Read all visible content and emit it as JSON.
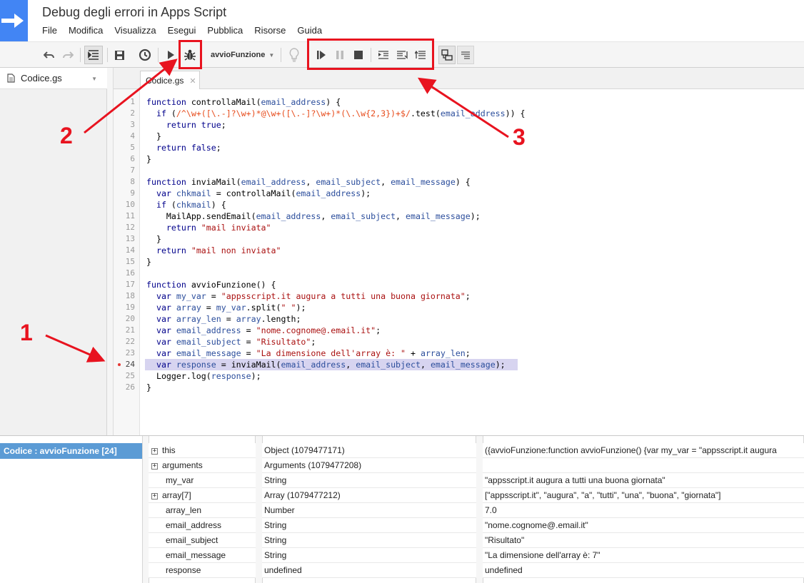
{
  "header": {
    "title": "Debug degli errori in Apps Script",
    "menu": [
      "File",
      "Modifica",
      "Visualizza",
      "Esegui",
      "Pubblica",
      "Risorse",
      "Guida"
    ]
  },
  "toolbar": {
    "function_select": "avvioFunzione",
    "icons": [
      "undo-icon",
      "redo-icon",
      "indent-icon",
      "save-icon",
      "triggers-icon",
      "run-icon",
      "debug-icon",
      "lightbulb-icon",
      "continue-icon",
      "pause-icon",
      "stop-icon",
      "step-into-icon",
      "step-over-icon",
      "step-out-icon",
      "split-view-icon",
      "log-view-icon"
    ]
  },
  "files": {
    "items": [
      {
        "name": "Codice.gs"
      }
    ]
  },
  "tabs": [
    {
      "label": "Codice.gs"
    }
  ],
  "editor": {
    "current_line": 24,
    "breakpoint_line": 24,
    "lines": [
      "function controllaMail(email_address) {",
      "  if (/^\\w+([\\.-]?\\w+)*@\\w+([\\.-]?\\w+)*(\\.\\w{2,3})+$/.test(email_address)) {",
      "    return true;",
      "  }",
      "  return false;",
      "}",
      "",
      "function inviaMail(email_address, email_subject, email_message) {",
      "  var chkmail = controllaMail(email_address);",
      "  if (chkmail) {",
      "    MailApp.sendEmail(email_address, email_subject, email_message);",
      "    return \"mail inviata\"",
      "  }",
      "  return \"mail non inviata\"",
      "}",
      "",
      "function avvioFunzione() {",
      "  var my_var = \"appsscript.it augura a tutti una buona giornata\";",
      "  var array = my_var.split(\" \");",
      "  var array_len = array.length;",
      "  var email_address = \"nome.cognome@.email.it\";",
      "  var email_subject = \"Risultato\";",
      "  var email_message = \"La dimensione dell'array è: \" + array_len;",
      "  var response = inviaMail(email_address, email_subject, email_message);",
      "  Logger.log(response);",
      "}"
    ]
  },
  "debugger": {
    "callstack": [
      "Codice : avvioFunzione [24]"
    ],
    "variables": [
      {
        "name": "this",
        "expandable": true,
        "type": "Object (1079477171)",
        "value": "({avvioFunzione:function avvioFunzione() {var my_var = \"appsscript.it augura"
      },
      {
        "name": "arguments",
        "expandable": true,
        "type": "Arguments (1079477208)",
        "value": ""
      },
      {
        "name": "my_var",
        "expandable": false,
        "type": "String",
        "value": "\"appsscript.it augura a tutti una buona giornata\""
      },
      {
        "name": "array[7]",
        "expandable": true,
        "type": "Array (1079477212)",
        "value": "[\"appsscript.it\", \"augura\", \"a\", \"tutti\", \"una\", \"buona\", \"giornata\"]"
      },
      {
        "name": "array_len",
        "expandable": false,
        "type": "Number",
        "value": "7.0"
      },
      {
        "name": "email_address",
        "expandable": false,
        "type": "String",
        "value": "\"nome.cognome@.email.it\""
      },
      {
        "name": "email_subject",
        "expandable": false,
        "type": "String",
        "value": "\"Risultato\""
      },
      {
        "name": "email_message",
        "expandable": false,
        "type": "String",
        "value": "\"La dimensione dell'array è: 7\""
      },
      {
        "name": "response",
        "expandable": false,
        "type": "undefined",
        "value": "undefined"
      }
    ]
  },
  "annotations": {
    "labels": [
      "1",
      "2",
      "3"
    ],
    "color": "#e8131f"
  },
  "colors": {
    "brand": "#4285f4",
    "keyword": "#00008b",
    "string": "#a11111",
    "regex": "#e74c1c",
    "variable": "#2c4e9c",
    "current_line": "#d7d4f0",
    "callstack_selected": "#5b9bd5"
  }
}
